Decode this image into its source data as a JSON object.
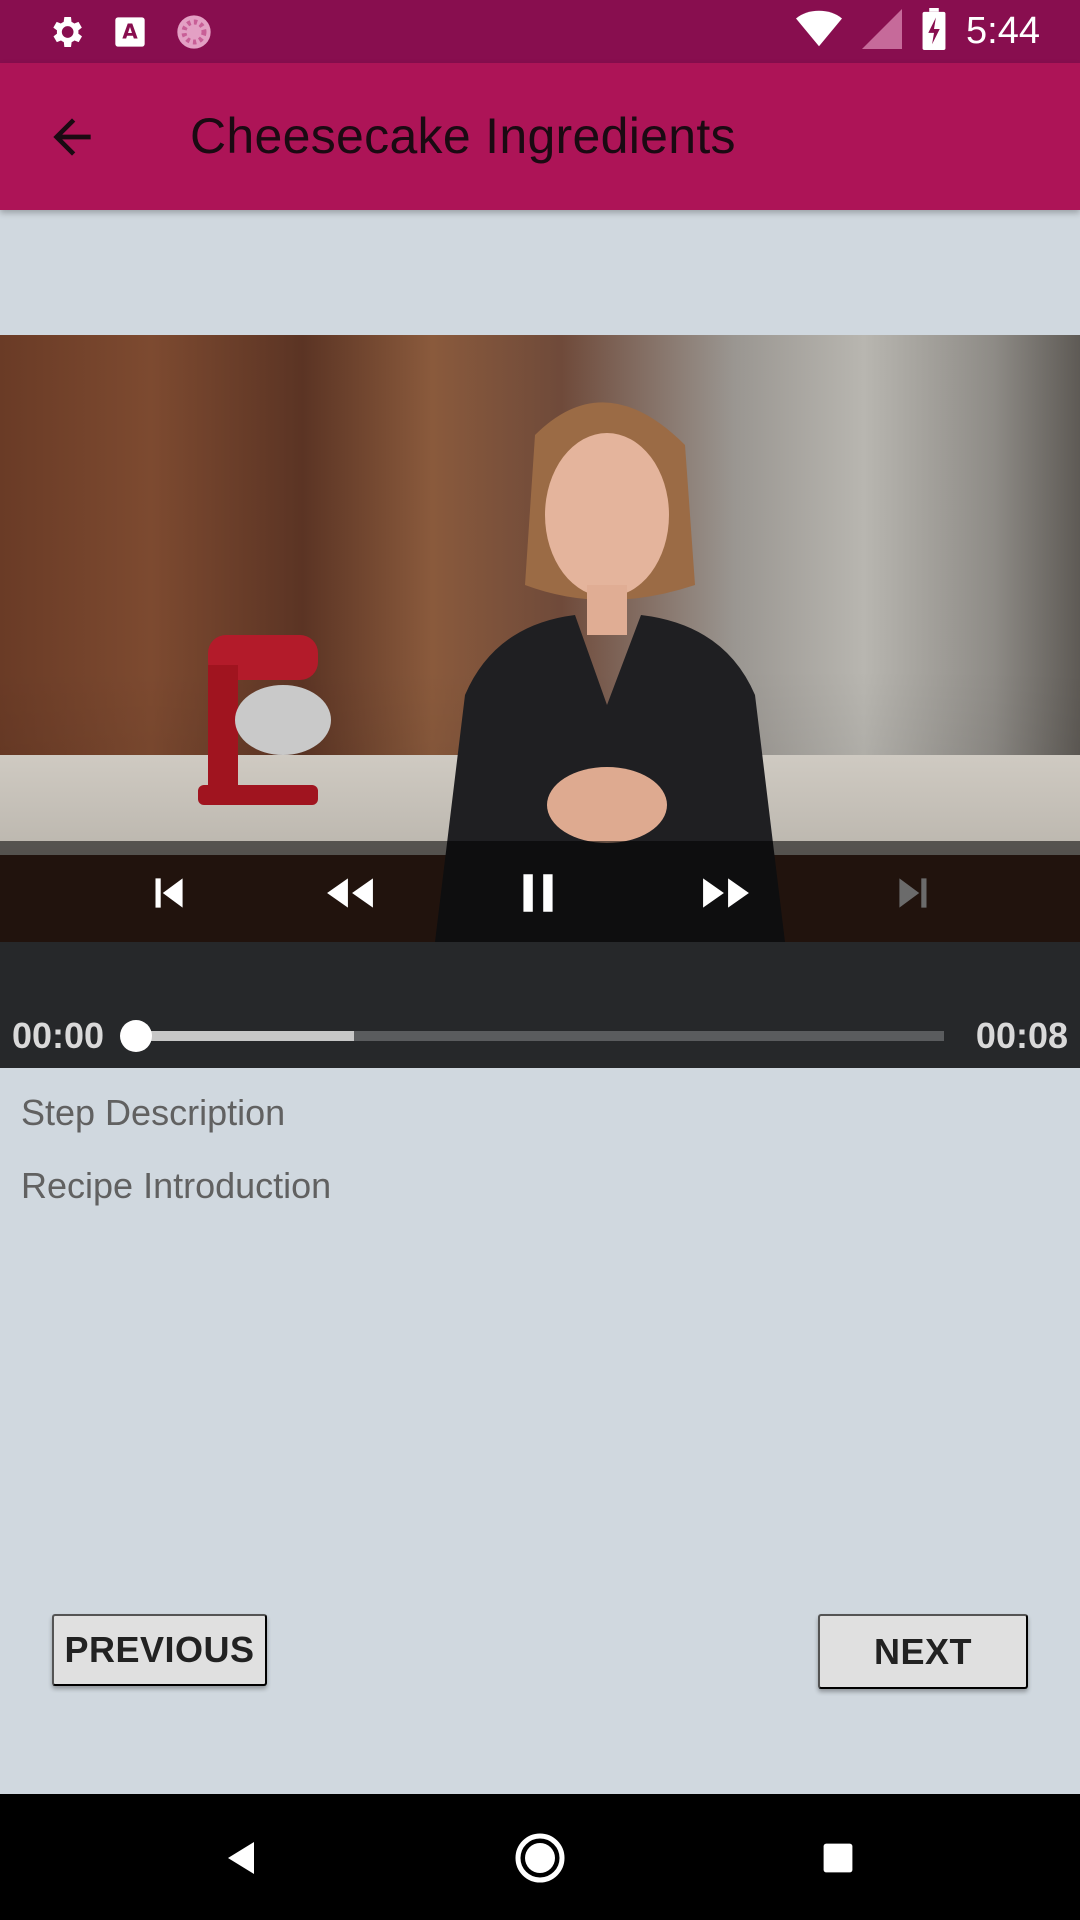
{
  "status_bar": {
    "time": "5:44",
    "left_icons": [
      "settings-icon",
      "font-a-icon",
      "loading-spinner-icon"
    ],
    "right_icons": [
      "wifi-icon",
      "cell-signal-icon",
      "battery-charging-icon"
    ]
  },
  "app_bar": {
    "title": "Cheesecake Ingredients",
    "back_icon": "arrow-back-icon"
  },
  "player": {
    "controls": [
      "skip-previous-icon",
      "rewind-icon",
      "pause-icon",
      "fast-forward-icon",
      "skip-next-icon"
    ],
    "position": "00:00",
    "duration": "00:08",
    "progress": 0,
    "buffered": 0.27
  },
  "step": {
    "label": "Step Description",
    "value": "Recipe Introduction"
  },
  "buttons": {
    "previous": "PREVIOUS",
    "next": "NEXT"
  },
  "nav_bar": {
    "icons": [
      "nav-back-icon",
      "nav-home-icon",
      "nav-recents-icon"
    ]
  },
  "colors": {
    "status_bar": "#880e4f",
    "app_bar": "#ad1457",
    "background": "#d0d8df"
  }
}
